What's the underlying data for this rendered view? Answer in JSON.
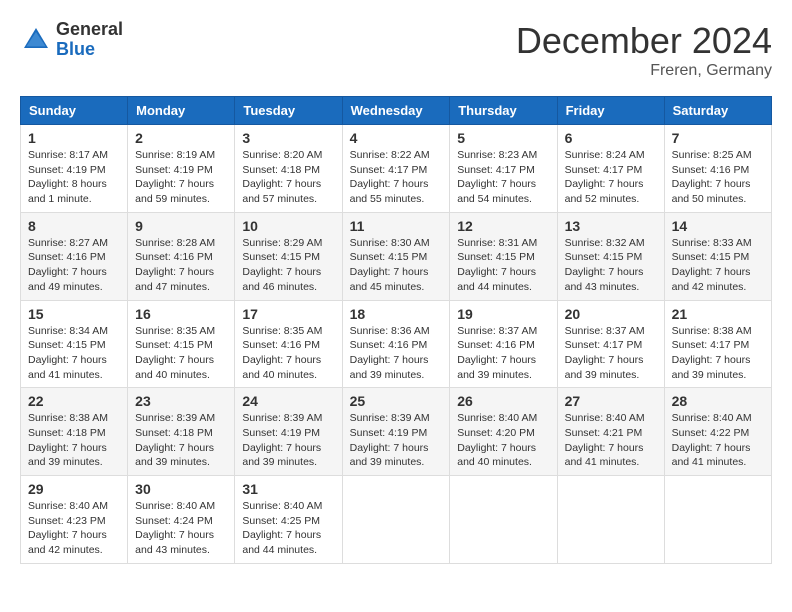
{
  "header": {
    "logo_general": "General",
    "logo_blue": "Blue",
    "month_title": "December 2024",
    "location": "Freren, Germany"
  },
  "weekdays": [
    "Sunday",
    "Monday",
    "Tuesday",
    "Wednesday",
    "Thursday",
    "Friday",
    "Saturday"
  ],
  "weeks": [
    [
      {
        "day": "1",
        "sunrise": "Sunrise: 8:17 AM",
        "sunset": "Sunset: 4:19 PM",
        "daylight": "Daylight: 8 hours and 1 minute."
      },
      {
        "day": "2",
        "sunrise": "Sunrise: 8:19 AM",
        "sunset": "Sunset: 4:19 PM",
        "daylight": "Daylight: 7 hours and 59 minutes."
      },
      {
        "day": "3",
        "sunrise": "Sunrise: 8:20 AM",
        "sunset": "Sunset: 4:18 PM",
        "daylight": "Daylight: 7 hours and 57 minutes."
      },
      {
        "day": "4",
        "sunrise": "Sunrise: 8:22 AM",
        "sunset": "Sunset: 4:17 PM",
        "daylight": "Daylight: 7 hours and 55 minutes."
      },
      {
        "day": "5",
        "sunrise": "Sunrise: 8:23 AM",
        "sunset": "Sunset: 4:17 PM",
        "daylight": "Daylight: 7 hours and 54 minutes."
      },
      {
        "day": "6",
        "sunrise": "Sunrise: 8:24 AM",
        "sunset": "Sunset: 4:17 PM",
        "daylight": "Daylight: 7 hours and 52 minutes."
      },
      {
        "day": "7",
        "sunrise": "Sunrise: 8:25 AM",
        "sunset": "Sunset: 4:16 PM",
        "daylight": "Daylight: 7 hours and 50 minutes."
      }
    ],
    [
      {
        "day": "8",
        "sunrise": "Sunrise: 8:27 AM",
        "sunset": "Sunset: 4:16 PM",
        "daylight": "Daylight: 7 hours and 49 minutes."
      },
      {
        "day": "9",
        "sunrise": "Sunrise: 8:28 AM",
        "sunset": "Sunset: 4:16 PM",
        "daylight": "Daylight: 7 hours and 47 minutes."
      },
      {
        "day": "10",
        "sunrise": "Sunrise: 8:29 AM",
        "sunset": "Sunset: 4:15 PM",
        "daylight": "Daylight: 7 hours and 46 minutes."
      },
      {
        "day": "11",
        "sunrise": "Sunrise: 8:30 AM",
        "sunset": "Sunset: 4:15 PM",
        "daylight": "Daylight: 7 hours and 45 minutes."
      },
      {
        "day": "12",
        "sunrise": "Sunrise: 8:31 AM",
        "sunset": "Sunset: 4:15 PM",
        "daylight": "Daylight: 7 hours and 44 minutes."
      },
      {
        "day": "13",
        "sunrise": "Sunrise: 8:32 AM",
        "sunset": "Sunset: 4:15 PM",
        "daylight": "Daylight: 7 hours and 43 minutes."
      },
      {
        "day": "14",
        "sunrise": "Sunrise: 8:33 AM",
        "sunset": "Sunset: 4:15 PM",
        "daylight": "Daylight: 7 hours and 42 minutes."
      }
    ],
    [
      {
        "day": "15",
        "sunrise": "Sunrise: 8:34 AM",
        "sunset": "Sunset: 4:15 PM",
        "daylight": "Daylight: 7 hours and 41 minutes."
      },
      {
        "day": "16",
        "sunrise": "Sunrise: 8:35 AM",
        "sunset": "Sunset: 4:15 PM",
        "daylight": "Daylight: 7 hours and 40 minutes."
      },
      {
        "day": "17",
        "sunrise": "Sunrise: 8:35 AM",
        "sunset": "Sunset: 4:16 PM",
        "daylight": "Daylight: 7 hours and 40 minutes."
      },
      {
        "day": "18",
        "sunrise": "Sunrise: 8:36 AM",
        "sunset": "Sunset: 4:16 PM",
        "daylight": "Daylight: 7 hours and 39 minutes."
      },
      {
        "day": "19",
        "sunrise": "Sunrise: 8:37 AM",
        "sunset": "Sunset: 4:16 PM",
        "daylight": "Daylight: 7 hours and 39 minutes."
      },
      {
        "day": "20",
        "sunrise": "Sunrise: 8:37 AM",
        "sunset": "Sunset: 4:17 PM",
        "daylight": "Daylight: 7 hours and 39 minutes."
      },
      {
        "day": "21",
        "sunrise": "Sunrise: 8:38 AM",
        "sunset": "Sunset: 4:17 PM",
        "daylight": "Daylight: 7 hours and 39 minutes."
      }
    ],
    [
      {
        "day": "22",
        "sunrise": "Sunrise: 8:38 AM",
        "sunset": "Sunset: 4:18 PM",
        "daylight": "Daylight: 7 hours and 39 minutes."
      },
      {
        "day": "23",
        "sunrise": "Sunrise: 8:39 AM",
        "sunset": "Sunset: 4:18 PM",
        "daylight": "Daylight: 7 hours and 39 minutes."
      },
      {
        "day": "24",
        "sunrise": "Sunrise: 8:39 AM",
        "sunset": "Sunset: 4:19 PM",
        "daylight": "Daylight: 7 hours and 39 minutes."
      },
      {
        "day": "25",
        "sunrise": "Sunrise: 8:39 AM",
        "sunset": "Sunset: 4:19 PM",
        "daylight": "Daylight: 7 hours and 39 minutes."
      },
      {
        "day": "26",
        "sunrise": "Sunrise: 8:40 AM",
        "sunset": "Sunset: 4:20 PM",
        "daylight": "Daylight: 7 hours and 40 minutes."
      },
      {
        "day": "27",
        "sunrise": "Sunrise: 8:40 AM",
        "sunset": "Sunset: 4:21 PM",
        "daylight": "Daylight: 7 hours and 41 minutes."
      },
      {
        "day": "28",
        "sunrise": "Sunrise: 8:40 AM",
        "sunset": "Sunset: 4:22 PM",
        "daylight": "Daylight: 7 hours and 41 minutes."
      }
    ],
    [
      {
        "day": "29",
        "sunrise": "Sunrise: 8:40 AM",
        "sunset": "Sunset: 4:23 PM",
        "daylight": "Daylight: 7 hours and 42 minutes."
      },
      {
        "day": "30",
        "sunrise": "Sunrise: 8:40 AM",
        "sunset": "Sunset: 4:24 PM",
        "daylight": "Daylight: 7 hours and 43 minutes."
      },
      {
        "day": "31",
        "sunrise": "Sunrise: 8:40 AM",
        "sunset": "Sunset: 4:25 PM",
        "daylight": "Daylight: 7 hours and 44 minutes."
      },
      null,
      null,
      null,
      null
    ]
  ]
}
